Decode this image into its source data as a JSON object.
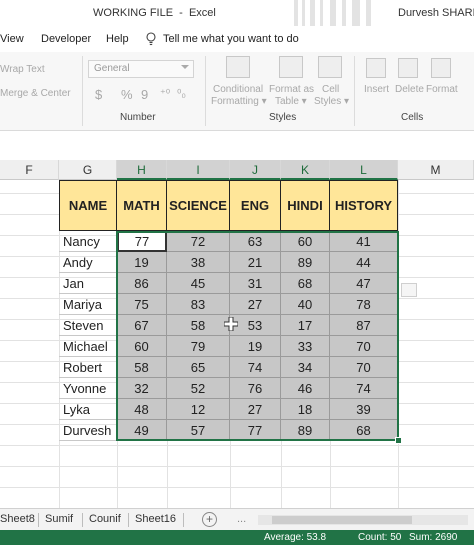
{
  "window": {
    "title": "WORKING FILE  -  Excel",
    "user": "Durvesh SHARMA"
  },
  "menu": {
    "items": [
      "View",
      "Developer",
      "Help"
    ],
    "tell_me": "Tell me what you want to do"
  },
  "ribbon": {
    "wrap_text": "Wrap Text",
    "merge_center": "Merge & Center",
    "number_format": "General",
    "currency": "$",
    "percent": "%",
    "comma": "9",
    "dec_inc": "⁺⁰",
    "dec_dec": "⁰₀",
    "groups": {
      "number": "Number",
      "styles": "Styles",
      "cells": "Cells"
    },
    "styles_buttons": [
      {
        "line1": "Conditional",
        "line2": "Formatting ▾"
      },
      {
        "line1": "Format as",
        "line2": "Table ▾"
      },
      {
        "line1": "Cell",
        "line2": "Styles ▾"
      }
    ],
    "cells_buttons": [
      "Insert",
      "Delete",
      "Format"
    ]
  },
  "columns": [
    "F",
    "G",
    "H",
    "I",
    "J",
    "K",
    "L",
    "M"
  ],
  "table": {
    "headers": [
      "NAME",
      "MATH",
      "SCIENCE",
      "ENG",
      "HINDI",
      "HISTORY"
    ],
    "rows": [
      {
        "name": "Nancy",
        "values": [
          77,
          72,
          63,
          60,
          41
        ]
      },
      {
        "name": "Andy",
        "values": [
          19,
          38,
          21,
          89,
          44
        ]
      },
      {
        "name": "Jan",
        "values": [
          86,
          45,
          31,
          68,
          47
        ]
      },
      {
        "name": "Mariya",
        "values": [
          75,
          83,
          27,
          40,
          78
        ]
      },
      {
        "name": "Steven",
        "values": [
          67,
          58,
          53,
          17,
          87
        ]
      },
      {
        "name": "Michael",
        "values": [
          60,
          79,
          19,
          33,
          70
        ]
      },
      {
        "name": "Robert",
        "values": [
          58,
          65,
          74,
          34,
          70
        ]
      },
      {
        "name": "Yvonne",
        "values": [
          32,
          52,
          76,
          46,
          74
        ]
      },
      {
        "name": "Lyka",
        "values": [
          48,
          12,
          27,
          18,
          39
        ]
      },
      {
        "name": "Durvesh",
        "values": [
          49,
          57,
          77,
          89,
          68
        ]
      }
    ]
  },
  "sheets": [
    "Sheet8",
    "Sumif",
    "Counif",
    "Sheet16"
  ],
  "add_sheet": "+",
  "more": "...",
  "status": {
    "average": "Average: 53.8",
    "count": "Count: 50",
    "sum": "Sum: 2690"
  },
  "colors": {
    "excel_green": "#217346",
    "header_fill": "#ffe699",
    "selection_fill": "#c7c7c7"
  }
}
